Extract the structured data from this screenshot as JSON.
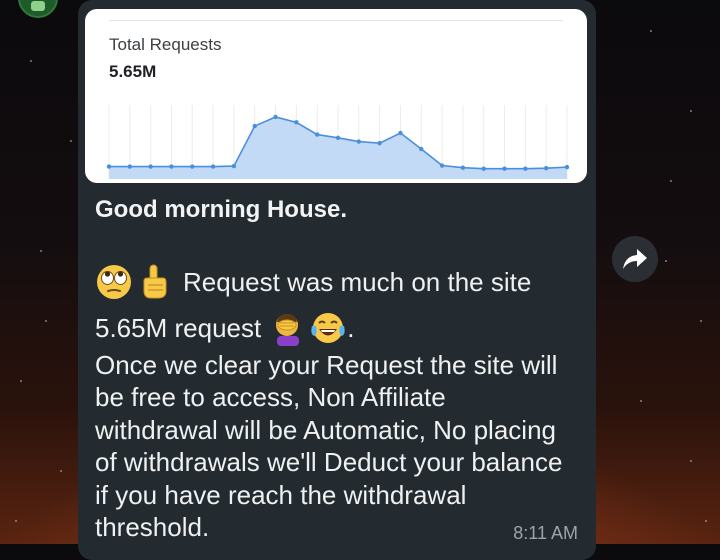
{
  "preview": {
    "stat_label": "Total Requests",
    "stat_value": "5.65M"
  },
  "message": {
    "heading": "Good morning House.",
    "line1_text": "Request was much on the site",
    "line2_text": "5.65M request",
    "line2_suffix": ".",
    "paragraph": "Once we clear your Request the site will be free to access, Non Affiliate withdrawal will be Automatic, No placing of withdrawals we'll Deduct your balance if you have reach the withdrawal threshold.",
    "time": "8:11 AM",
    "emojis": [
      "face-with-rolling-eyes-icon",
      "index-pointing-up-icon",
      "facepalm-icon",
      "tears-of-joy-icon"
    ]
  },
  "icons": {
    "forward": "forward-arrow-icon",
    "avatar": "group-avatar"
  },
  "colors": {
    "bubble": "#232b30",
    "chart_line": "#4a8fdb",
    "chart_fill": "#c3daf6",
    "text": "#eef0f1",
    "timestamp": "#9ea4a7"
  },
  "chart_data": {
    "type": "area",
    "title": "Total Requests",
    "total": "5.65M",
    "x": [
      1,
      2,
      3,
      4,
      5,
      6,
      7,
      8,
      9,
      10,
      11,
      12,
      13,
      14,
      15,
      16,
      17,
      18,
      19,
      20,
      21,
      22,
      23
    ],
    "series": [
      {
        "values": [
          0.02,
          0.02,
          0.02,
          0.02,
          0.02,
          0.02,
          0.03,
          0.78,
          0.95,
          0.85,
          0.62,
          0.56,
          0.49,
          0.46,
          0.65,
          0.35,
          0.04,
          0.0,
          -0.02,
          -0.02,
          -0.02,
          -0.01,
          0.01
        ]
      }
    ],
    "ylim": [
      -0.1,
      1.1
    ],
    "grid": true,
    "legend": "none"
  }
}
